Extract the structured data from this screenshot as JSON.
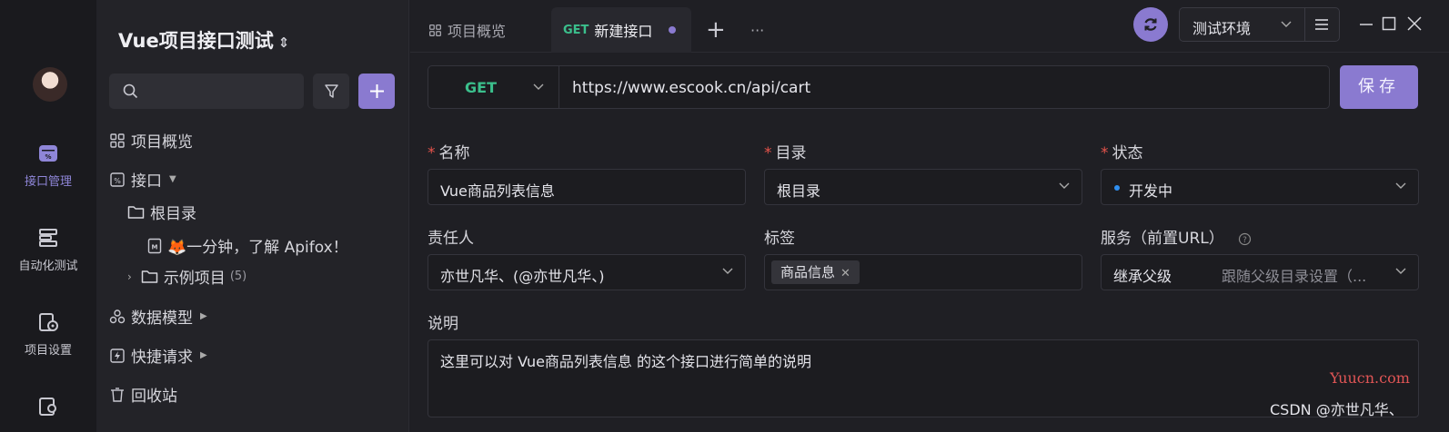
{
  "rail": {
    "items": [
      {
        "label": "接口管理",
        "icon": "api-icon"
      },
      {
        "label": "自动化测试",
        "icon": "automation-icon"
      },
      {
        "label": "项目设置",
        "icon": "settings-icon"
      },
      {
        "label": "",
        "icon": "members-icon"
      }
    ],
    "active_color": "#8f86d8"
  },
  "sidebar": {
    "project_title": "Vue项目接口测试",
    "project_chevron": "⌃⌄",
    "tree": {
      "overview": "项目概览",
      "apis": "接口",
      "root": "根目录",
      "doc": "🦊一分钟，了解 Apifox！",
      "examples": "示例项目",
      "examples_count": "(5)",
      "schemas": "数据模型",
      "quick": "快捷请求",
      "trash": "回收站"
    }
  },
  "tabs": {
    "overview": "项目概览",
    "new_method": "GET",
    "new_label": "新建接口",
    "add": "+",
    "more": "···"
  },
  "env": {
    "label": "测试环境"
  },
  "request": {
    "method": "GET",
    "url": "https://www.escook.cn/api/cart",
    "save": "保存"
  },
  "form": {
    "name_label": "名称",
    "name_value": "Vue商品列表信息",
    "dir_label": "目录",
    "dir_value": "根目录",
    "status_label": "状态",
    "status_value": "开发中",
    "owner_label": "责任人",
    "owner_value": "亦世凡华、(@亦世凡华、)",
    "tags_label": "标签",
    "tag_value": "商品信息",
    "service_label": "服务（前置URL）",
    "service_value": "继承父级",
    "service_hint": "跟随父级目录设置（...",
    "desc_label": "说明",
    "desc_value": "这里可以对 Vue商品列表信息 的这个接口进行简单的说明"
  },
  "watermarks": {
    "site": "Yuucn.com",
    "author": "CSDN @亦世凡华、"
  },
  "colors": {
    "accent": "#8a7ad0",
    "get": "#3bbf8c",
    "required": "#e5534b",
    "status_dot": "#2f8ff0"
  }
}
